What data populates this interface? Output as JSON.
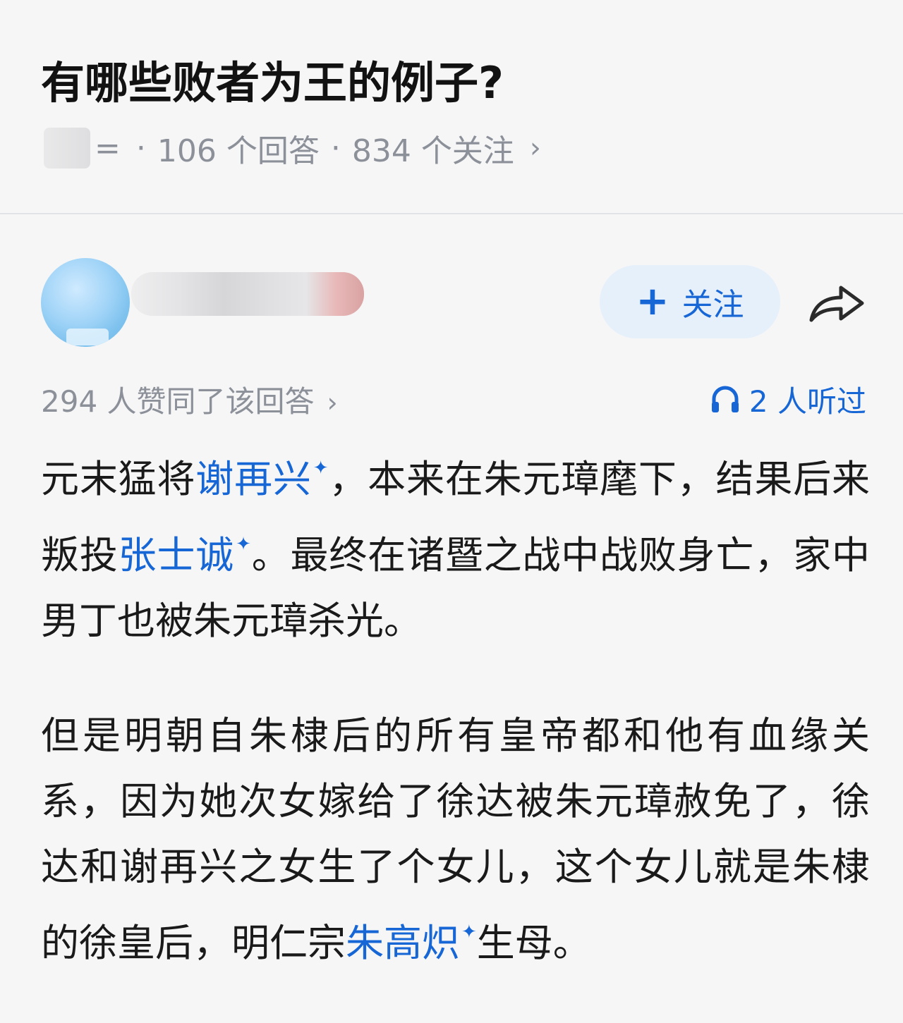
{
  "question": {
    "title": "有哪些败者为王的例子?",
    "meta_partial": "=",
    "answers": "106 个回答",
    "follows": "834 个关注",
    "separator": "·",
    "chevron": "›"
  },
  "author": {
    "follow_label": "关注",
    "plus_glyph": "+"
  },
  "stats": {
    "upvotes": "294 人赞同了该回答",
    "chevron": "›",
    "listens": "2 人听过"
  },
  "answer": {
    "p1": {
      "t1": "元末猛将",
      "l1": "谢再兴",
      "t2": "，本来在朱元璋麾下，结果后来叛投",
      "l2": "张士诚",
      "t3": "。最终在诸暨之战中战败身亡，家中男丁也被朱元璋杀光。"
    },
    "p2": {
      "t1": "但是明朝自朱棣后的所有皇帝都和他有血缘关系，因为她次女嫁给了徐达被朱元璋赦免了，徐达和谢再兴之女生了个女儿，这个女儿就是朱棣的徐皇后，明仁宗",
      "l1": "朱高炽",
      "t2": "生母。"
    },
    "spark": "✦"
  },
  "colors": {
    "link": "#1766d6",
    "follow_bg": "#e6f0fb",
    "meta_text": "#8c9099",
    "background": "#f6f6f7"
  },
  "icons": {
    "share": "share-arrow-icon",
    "listen": "headphones-icon",
    "link_marker": "sparkle-icon"
  }
}
